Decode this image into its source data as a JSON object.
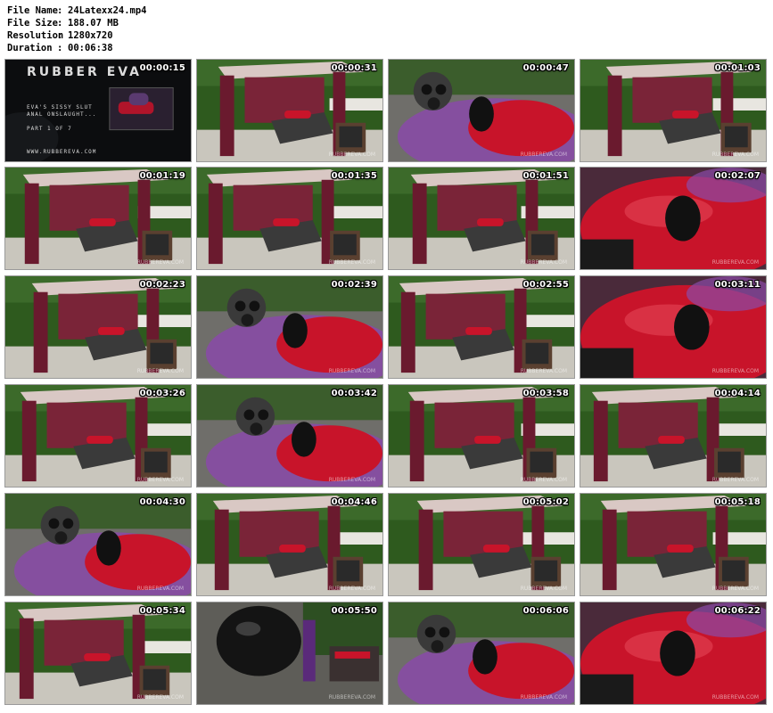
{
  "file_info": [
    {
      "key": "File Name",
      "sep": ":",
      "value": "24Latexx24.mp4"
    },
    {
      "key": "File Size",
      "sep": ":",
      "value": "188.07 MB"
    },
    {
      "key": "Resolution",
      "sep": ":",
      "value": "1280x720"
    },
    {
      "key": "Duration",
      "sep": ":",
      "value": "00:06:38"
    }
  ],
  "title_card": {
    "logo": "RUBBER EVA",
    "line1": "EVA'S SISSY SLUT",
    "line2": "ANAL ONSLAUGHT...",
    "line3": "PART 1 OF 7",
    "url": "WWW.RUBBEREVA.COM"
  },
  "watermark": "RUBBEREVA.COM",
  "thumbnails": [
    {
      "time": "00:00:15",
      "scene": "title"
    },
    {
      "time": "00:00:31",
      "scene": "gazebo"
    },
    {
      "time": "00:00:47",
      "scene": "closeup-mask"
    },
    {
      "time": "00:01:03",
      "scene": "gazebo"
    },
    {
      "time": "00:01:19",
      "scene": "gazebo"
    },
    {
      "time": "00:01:35",
      "scene": "gazebo"
    },
    {
      "time": "00:01:51",
      "scene": "gazebo"
    },
    {
      "time": "00:02:07",
      "scene": "closeup-red"
    },
    {
      "time": "00:02:23",
      "scene": "gazebo"
    },
    {
      "time": "00:02:39",
      "scene": "closeup-mask"
    },
    {
      "time": "00:02:55",
      "scene": "gazebo"
    },
    {
      "time": "00:03:11",
      "scene": "closeup-red"
    },
    {
      "time": "00:03:26",
      "scene": "gazebo"
    },
    {
      "time": "00:03:42",
      "scene": "closeup-mask"
    },
    {
      "time": "00:03:58",
      "scene": "gazebo"
    },
    {
      "time": "00:04:14",
      "scene": "gazebo"
    },
    {
      "time": "00:04:30",
      "scene": "closeup-mask"
    },
    {
      "time": "00:04:46",
      "scene": "gazebo"
    },
    {
      "time": "00:05:02",
      "scene": "gazebo"
    },
    {
      "time": "00:05:18",
      "scene": "gazebo"
    },
    {
      "time": "00:05:34",
      "scene": "gazebo"
    },
    {
      "time": "00:05:50",
      "scene": "closeup-dark"
    },
    {
      "time": "00:06:06",
      "scene": "closeup-mask"
    },
    {
      "time": "00:06:22",
      "scene": "closeup-red"
    }
  ],
  "colors": {
    "page_bg": "#ffffff",
    "thumb_border": "#9a9a9a",
    "timestamp": "#ffffff",
    "latex_red": "#c8142a",
    "curtain": "#6a1a2e",
    "foliage": "#2e5a1e",
    "gravel": "#c9c6bd",
    "purple_sheet": "#8a4aa8"
  }
}
